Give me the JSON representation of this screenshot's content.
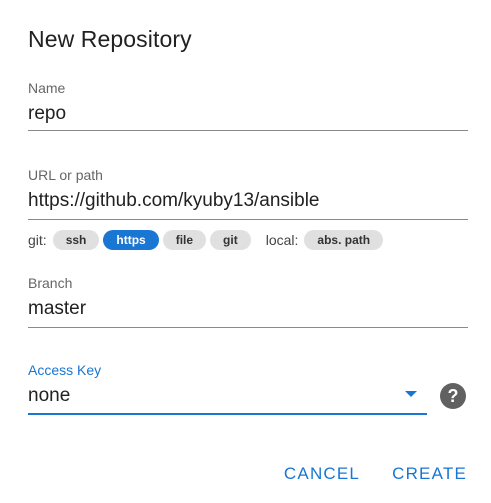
{
  "dialog": {
    "title": "New Repository"
  },
  "name_field": {
    "label": "Name",
    "value": "repo"
  },
  "url_field": {
    "label": "URL or path",
    "value": "https://github.com/kyuby13/ansible"
  },
  "protocols": {
    "git_label": "git:",
    "git_chips": [
      {
        "label": "ssh",
        "active": false
      },
      {
        "label": "https",
        "active": true
      },
      {
        "label": "file",
        "active": false
      },
      {
        "label": "git",
        "active": false
      }
    ],
    "local_label": "local:",
    "local_chips": [
      {
        "label": "abs. path",
        "active": false
      }
    ]
  },
  "branch_field": {
    "label": "Branch",
    "value": "master"
  },
  "access_key_field": {
    "label": "Access Key",
    "value": "none"
  },
  "help": {
    "icon": "help-circle-icon",
    "glyph": "?"
  },
  "actions": {
    "cancel_label": "CANCEL",
    "create_label": "CREATE"
  },
  "colors": {
    "accent": "#1976d2",
    "chip_bg": "#e0e0e0",
    "text": "#212121"
  }
}
